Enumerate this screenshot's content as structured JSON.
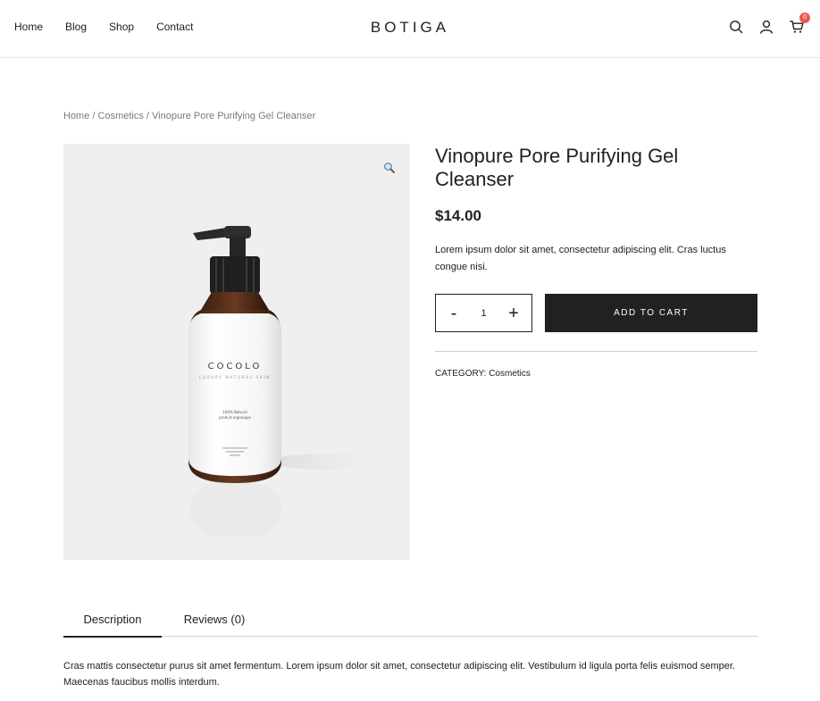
{
  "header": {
    "nav": [
      "Home",
      "Blog",
      "Shop",
      "Contact"
    ],
    "logo": "BOTIGA",
    "cart_count": "0",
    "icons": [
      "search-icon",
      "user-icon",
      "cart-icon"
    ]
  },
  "breadcrumb": {
    "home": "Home",
    "category": "Cosmetics",
    "current": "Vinopure Pore Purifying Gel Cleanser",
    "sep": " / "
  },
  "product": {
    "title": "Vinopure Pore Purifying Gel Cleanser",
    "price": "$14.00",
    "short_description": "Lorem ipsum dolor sit amet, consectetur adipiscing elit. Cras luctus congue nisi.",
    "quantity": "1",
    "qty_minus": "-",
    "qty_plus": "+",
    "add_to_cart": "ADD TO CART",
    "category_label": "CATEGORY:",
    "category_value": "Cosmetics",
    "image": {
      "brand": "COCOLO",
      "tagline": "LUXURY NATURAL SKIN",
      "line1": "100% Natural",
      "line2": "produit organique"
    }
  },
  "tabs": {
    "items": [
      "Description",
      "Reviews (0)"
    ],
    "active": "Description",
    "content": "Cras mattis consectetur purus sit amet fermentum. Lorem ipsum dolor sit amet, consectetur adipiscing elit. Vestibulum id ligula porta felis euismod semper. Maecenas faucibus mollis interdum."
  },
  "colors": {
    "text": "#212121",
    "muted": "#7a7a7a",
    "button_bg": "#212121",
    "badge": "#ee5555",
    "image_bg": "#efefef"
  }
}
